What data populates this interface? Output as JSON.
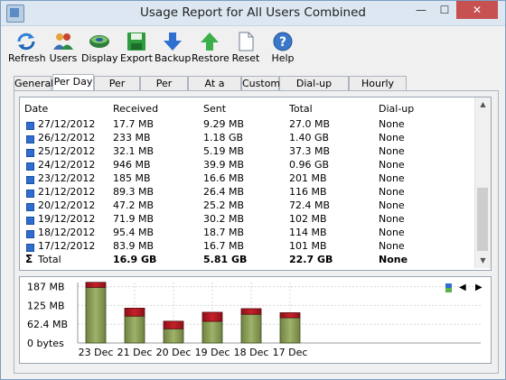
{
  "window": {
    "title": "Usage Report for All Users Combined",
    "minimize": "—",
    "maximize": "☐",
    "close": "✕"
  },
  "toolbar": [
    {
      "name": "refresh",
      "label": "Refresh"
    },
    {
      "name": "users",
      "label": "Users"
    },
    {
      "name": "display",
      "label": "Display"
    },
    {
      "name": "export",
      "label": "Export"
    },
    {
      "name": "backup",
      "label": "Backup"
    },
    {
      "name": "restore",
      "label": "Restore"
    },
    {
      "name": "reset",
      "label": "Reset"
    },
    {
      "name": "help",
      "label": "Help"
    }
  ],
  "tabs": [
    {
      "label": "General",
      "active": false
    },
    {
      "label": "Per Day",
      "active": true
    },
    {
      "label": "Per Week",
      "active": false
    },
    {
      "label": "Per Month",
      "active": false
    },
    {
      "label": "At a Glance",
      "active": false
    },
    {
      "label": "Custom",
      "active": false
    },
    {
      "label": "Dial-up Sessions",
      "active": false
    },
    {
      "label": "Hourly Rates",
      "active": false
    }
  ],
  "table": {
    "columns": [
      "Date",
      "Received",
      "Sent",
      "Total",
      "Dial-up"
    ],
    "rows": [
      [
        "27/12/2012",
        "17.7 MB",
        "9.29 MB",
        "27.0 MB",
        "None"
      ],
      [
        "26/12/2012",
        "233 MB",
        "1.18 GB",
        "1.40 GB",
        "None"
      ],
      [
        "25/12/2012",
        "32.1 MB",
        "5.19 MB",
        "37.3 MB",
        "None"
      ],
      [
        "24/12/2012",
        "946 MB",
        "39.9 MB",
        "0.96 GB",
        "None"
      ],
      [
        "23/12/2012",
        "185 MB",
        "16.6 MB",
        "201 MB",
        "None"
      ],
      [
        "21/12/2012",
        "89.3 MB",
        "26.4 MB",
        "116 MB",
        "None"
      ],
      [
        "20/12/2012",
        "47.2 MB",
        "25.2 MB",
        "72.4 MB",
        "None"
      ],
      [
        "19/12/2012",
        "71.9 MB",
        "30.2 MB",
        "102 MB",
        "None"
      ],
      [
        "18/12/2012",
        "95.4 MB",
        "18.7 MB",
        "114 MB",
        "None"
      ],
      [
        "17/12/2012",
        "83.9 MB",
        "16.7 MB",
        "101 MB",
        "None"
      ]
    ],
    "total": {
      "symbol": "Σ",
      "label": "Total",
      "received": "16.9 GB",
      "sent": "5.81 GB",
      "total": "22.7 GB",
      "dialup": "None"
    }
  },
  "scrollbar": {
    "up": "▲",
    "down": "▼"
  },
  "chart_tools": {
    "prev": "◀",
    "next": "▶"
  },
  "chart_data": {
    "type": "bar",
    "categories": [
      "23 Dec",
      "21 Dec",
      "20 Dec",
      "19 Dec",
      "18 Dec",
      "17 Dec"
    ],
    "series": [
      {
        "values": [
          185,
          89.3,
          47.2,
          71.9,
          95.4,
          83.9
        ],
        "color": "#9fb26a"
      },
      {
        "values": [
          16.6,
          26.4,
          25.2,
          30.2,
          18.7,
          16.7
        ],
        "color": "#c8202a"
      }
    ],
    "y_ticks": [
      "187 MB",
      "125 MB",
      "62.4 MB",
      "0 bytes"
    ],
    "y_tick_values": [
      187,
      125,
      62.4,
      0
    ],
    "ylim": [
      0,
      201
    ],
    "grid": true
  },
  "colors": {
    "received": "#9fb26a",
    "sent": "#c8202a",
    "row_marker": "#2f6ed0"
  }
}
